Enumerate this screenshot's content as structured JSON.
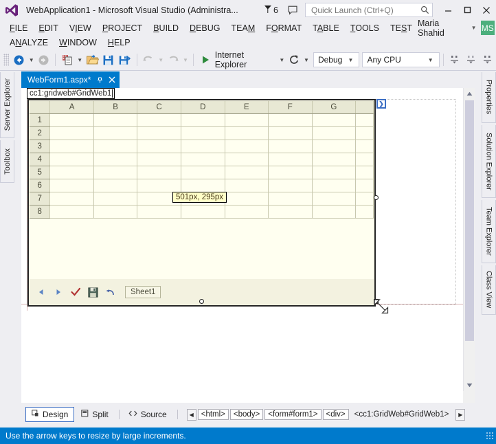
{
  "window": {
    "title": "WebApplication1 - Microsoft Visual Studio (Administra...",
    "logo_icon": "visual-studio-logo",
    "notification_icon": "flag-icon",
    "notification_count": "6",
    "feedback_icon": "feedback-comment-icon",
    "minimize_icon": "minimize-icon",
    "maximize_icon": "maximize-icon",
    "close_icon": "close-icon",
    "accent_color": "#007ACC",
    "chrome_color": "#EEEEF2"
  },
  "quick_launch": {
    "placeholder": "Quick Launch (Ctrl+Q)",
    "value": "",
    "search_icon": "search-icon"
  },
  "menu": {
    "row1": [
      {
        "label": "FILE",
        "accel": "F"
      },
      {
        "label": "EDIT",
        "accel": "E"
      },
      {
        "label": "VIEW",
        "accel": "V"
      },
      {
        "label": "PROJECT",
        "accel": "P"
      },
      {
        "label": "BUILD",
        "accel": "B"
      },
      {
        "label": "DEBUG",
        "accel": "D"
      },
      {
        "label": "TEAM",
        "accel": "M"
      },
      {
        "label": "FORMAT",
        "accel": "O"
      },
      {
        "label": "TABLE",
        "accel": "A"
      },
      {
        "label": "TOOLS",
        "accel": "T"
      },
      {
        "label": "TEST",
        "accel": "S"
      }
    ],
    "row2": [
      {
        "label": "ANALYZE",
        "accel": "N"
      },
      {
        "label": "WINDOW",
        "accel": "W"
      },
      {
        "label": "HELP",
        "accel": "H"
      }
    ]
  },
  "user": {
    "name": "Maria Shahid",
    "caret_icon": "chevron-down-icon",
    "avatar_initials": "MS",
    "avatar_color": "#4CAF7D"
  },
  "toolbar": {
    "grip_icon": "drag-grip-icon",
    "back_icon": "navigate-back-icon",
    "back_caret_icon": "chevron-down-icon",
    "forward_icon": "navigate-forward-icon",
    "new_project_icon": "new-project-icon",
    "new_project_caret_icon": "chevron-down-icon",
    "open_file_icon": "open-file-icon",
    "save_icon": "save-icon",
    "save_all_icon": "save-all-icon",
    "undo_icon": "undo-icon",
    "undo_caret_icon": "chevron-down-icon",
    "redo_icon": "redo-icon",
    "redo_caret_icon": "chevron-down-icon",
    "run_icon": "play-icon",
    "run_label": "Internet Explorer",
    "run_caret_icon": "chevron-down-icon",
    "refresh_icon": "refresh-icon",
    "refresh_caret_icon": "chevron-down-icon",
    "config_value": "Debug",
    "config_caret_icon": "chevron-down-icon",
    "platform_value": "Any CPU",
    "platform_caret_icon": "chevron-down-icon",
    "align_icon_1": "align-bottom-icon",
    "align_icon_2": "align-middle-icon",
    "align_icon_3": "align-top-icon"
  },
  "dock_left": {
    "items": [
      {
        "label": "Server Explorer"
      },
      {
        "label": "Toolbox"
      }
    ]
  },
  "dock_right": {
    "items": [
      {
        "label": "Properties"
      },
      {
        "label": "Solution Explorer"
      },
      {
        "label": "Team Explorer"
      },
      {
        "label": "Class View"
      }
    ]
  },
  "document_tab": {
    "label": "WebForm1.aspx*",
    "pin_icon": "pin-icon",
    "close_icon": "close-icon"
  },
  "designer": {
    "tag_selector": "cc1:gridweb#GridWeb1",
    "smart_tag_icon": "smart-tag-chevron-icon",
    "size_tooltip": "501px, 295px",
    "resize_cursor_icon": "resize-diagonal-cursor-icon"
  },
  "gridweb": {
    "column_headers": [
      "A",
      "B",
      "C",
      "D",
      "E",
      "F",
      "G"
    ],
    "partial_column": "",
    "row_headers": [
      "1",
      "2",
      "3",
      "4",
      "5",
      "6",
      "7",
      "8"
    ],
    "cells": [
      [
        "",
        "",
        "",
        "",
        "",
        "",
        "",
        ""
      ],
      [
        "",
        "",
        "",
        "",
        "",
        "",
        "",
        ""
      ],
      [
        "",
        "",
        "",
        "",
        "",
        "",
        "",
        ""
      ],
      [
        "",
        "",
        "",
        "",
        "",
        "",
        "",
        ""
      ],
      [
        "",
        "",
        "",
        "",
        "",
        "",
        "",
        ""
      ],
      [
        "",
        "",
        "",
        "",
        "",
        "",
        "",
        ""
      ],
      [
        "",
        "",
        "",
        "",
        "",
        "",
        "",
        ""
      ],
      [
        "",
        "",
        "",
        "",
        "",
        "",
        "",
        ""
      ]
    ],
    "toolbar": {
      "prev_icon": "triangle-left-icon",
      "next_icon": "triangle-right-icon",
      "submit_icon": "checkmark-icon",
      "save_icon": "floppy-save-icon",
      "undo_icon": "undo-arrow-icon"
    },
    "sheet_tab": "Sheet1",
    "header_bg": "#E8E8D4",
    "cell_bg": "#FFFFF0",
    "body_bg": "#F3F2E0"
  },
  "view_bar": {
    "tabs": [
      {
        "label": "Design",
        "icon": "design-view-icon",
        "active": true
      },
      {
        "label": "Split",
        "icon": "split-view-icon",
        "active": false
      },
      {
        "label": "Source",
        "icon": "source-view-icon",
        "active": false
      }
    ],
    "prev_icon": "triangle-left-icon",
    "next_icon": "triangle-right-icon",
    "breadcrumbs": [
      {
        "label": "<html>",
        "boxed": true
      },
      {
        "label": "<body>",
        "boxed": true
      },
      {
        "label": "<form#form1>",
        "boxed": true
      },
      {
        "label": "<div>",
        "boxed": true
      },
      {
        "label": "<cc1:GridWeb#GridWeb1>",
        "boxed": false
      }
    ]
  },
  "status_bar": {
    "message": "Use the arrow keys to resize by large increments.",
    "grip_icon": "resize-grip-icon",
    "background": "#007ACC"
  }
}
